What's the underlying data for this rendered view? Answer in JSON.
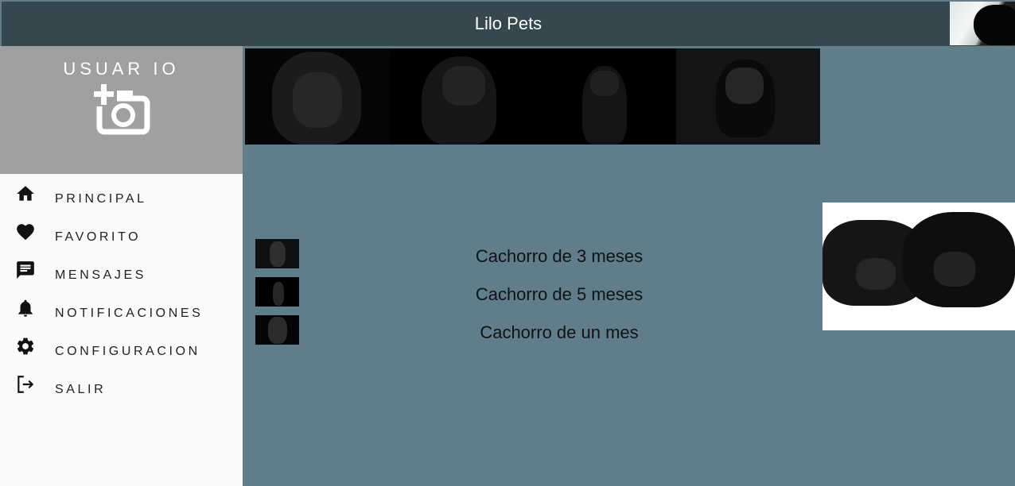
{
  "app": {
    "title": "Lilo Pets"
  },
  "sidebar": {
    "user_label": "USUAR IO",
    "items": [
      {
        "label": "PRINCIPAL",
        "icon": "home-icon"
      },
      {
        "label": "FAVORITO",
        "icon": "heart-icon"
      },
      {
        "label": "MENSAJES",
        "icon": "message-icon"
      },
      {
        "label": "NOTIFICACIONES",
        "icon": "bell-icon"
      },
      {
        "label": "CONFIGURACION",
        "icon": "gear-icon"
      },
      {
        "label": "SALIR",
        "icon": "logout-icon"
      }
    ]
  },
  "main": {
    "items": [
      {
        "label": "Cachorro de 3 meses"
      },
      {
        "label": "Cachorro de 5 meses"
      },
      {
        "label": "Cachorro de un mes"
      }
    ]
  },
  "colors": {
    "topbar": "#37474f",
    "background": "#607d8b",
    "sidebar": "#fafafa",
    "user_panel": "#a0a0a0"
  }
}
